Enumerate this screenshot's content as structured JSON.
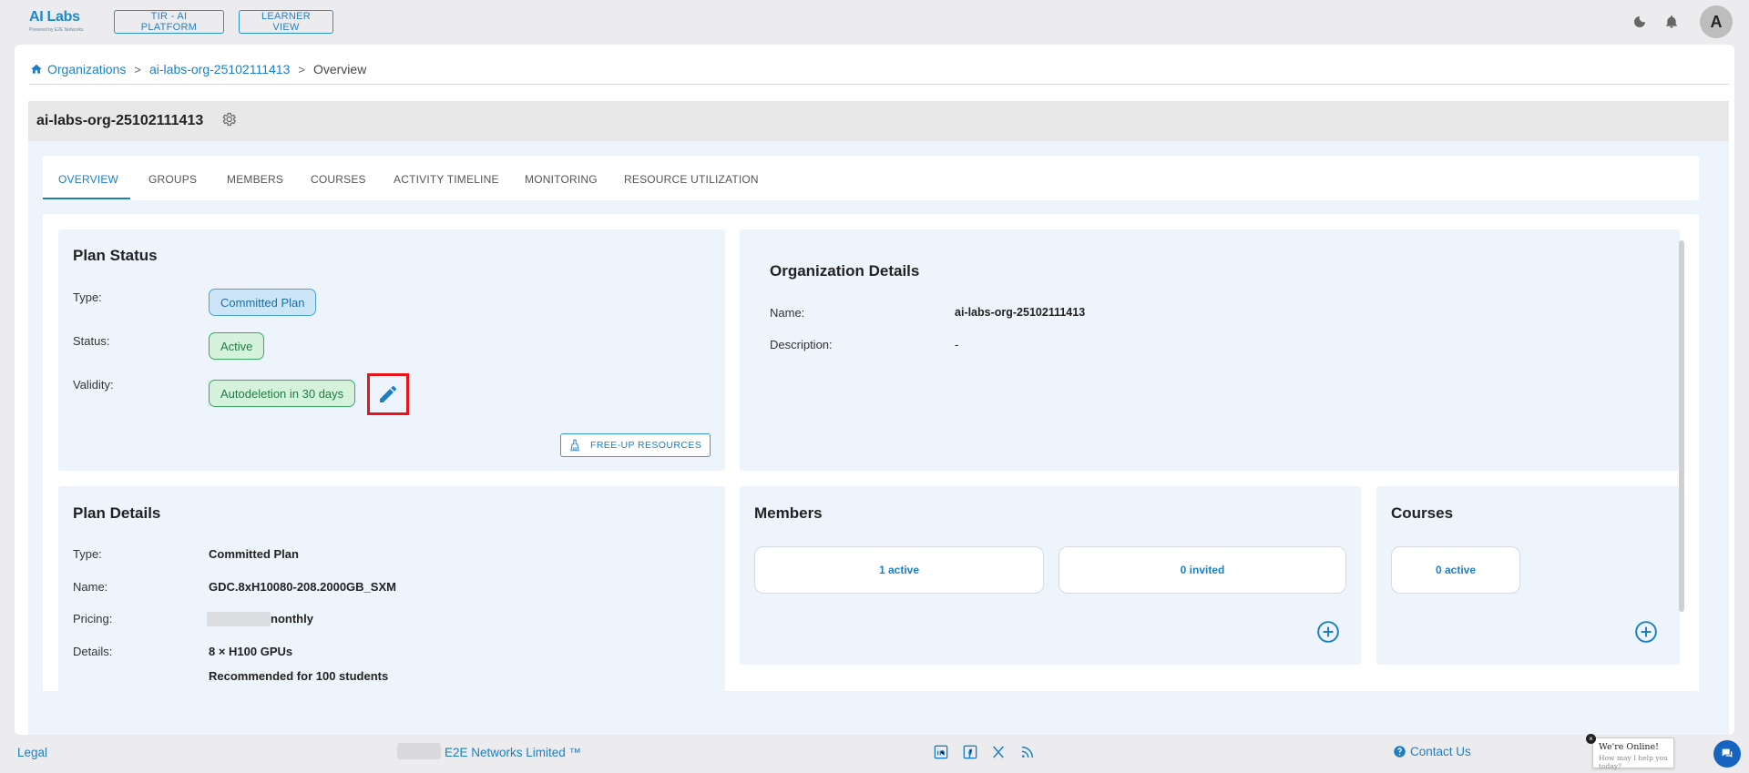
{
  "header": {
    "logo_text": "AI Labs",
    "logo_subtext": "Powered by E2E Networks",
    "nav_buttons": [
      "TIR - AI PLATFORM",
      "LEARNER VIEW"
    ],
    "avatar_initial": "A",
    "icons": [
      "moon-icon",
      "bell-icon"
    ]
  },
  "breadcrumb": {
    "items": [
      "Organizations",
      "ai-labs-org-25102111413",
      "Overview"
    ],
    "separator": ">"
  },
  "org": {
    "title": "ai-labs-org-25102111413"
  },
  "tabs": [
    "OVERVIEW",
    "GROUPS",
    "MEMBERS",
    "COURSES",
    "ACTIVITY TIMELINE",
    "MONITORING",
    "RESOURCE UTILIZATION"
  ],
  "active_tab": "OVERVIEW",
  "plan_status": {
    "title": "Plan Status",
    "type_label": "Type:",
    "type_value": "Committed Plan",
    "status_label": "Status:",
    "status_value": "Active",
    "validity_label": "Validity:",
    "validity_value": "Autodeletion in 30 days",
    "freeup_button": "FREE-UP RESOURCES"
  },
  "org_details": {
    "title": "Organization Details",
    "name_label": "Name:",
    "name_value": "ai-labs-org-25102111413",
    "description_label": "Description:",
    "description_value": "-"
  },
  "plan_details": {
    "title": "Plan Details",
    "type_label": "Type:",
    "type_value": "Committed Plan",
    "name_label": "Name:",
    "name_value": "GDC.8xH10080-208.2000GB_SXM",
    "pricing_label": "Pricing:",
    "pricing_value": "nonthly",
    "details_label": "Details:",
    "details_line1": "8 × H100 GPUs",
    "details_line2": "Recommended for 100 students"
  },
  "members": {
    "title": "Members",
    "active": "1 active",
    "invited": "0 invited"
  },
  "courses": {
    "title": "Courses",
    "active": "0 active"
  },
  "footer": {
    "legal": "Legal",
    "company": "E2E Networks Limited ™",
    "social_icons": [
      "linkedin-icon",
      "facebook-icon",
      "x-icon",
      "rss-icon"
    ],
    "contact": "Contact Us"
  },
  "chat": {
    "title": "We're Online!",
    "subtitle": "How may I help you today?",
    "close": "×"
  },
  "colors": {
    "accent": "#1b7fc4",
    "highlight_border": "#e8131b",
    "success_bg": "#d5f2dc",
    "info_bg": "#cde6f7",
    "panel_bg": "#edf4fb"
  }
}
